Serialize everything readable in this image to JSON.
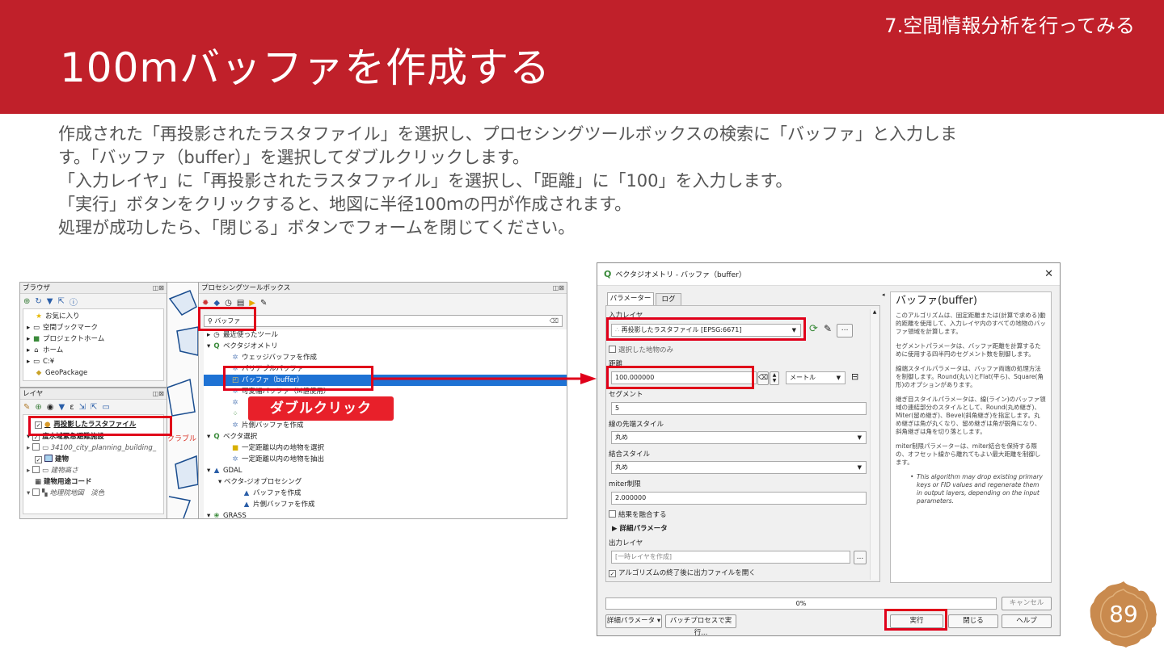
{
  "header": {
    "section": "7.空間情報分析を行ってみる",
    "title": "100mバッファを作成する"
  },
  "instructions": [
    "作成された「再投影されたラスタファイル」を選択し、プロセシングツールボックスの検索に「バッファ」と入力しま",
    "す。「バッファ（buffer）」を選択してダブルクリックします。",
    "「入力レイヤ」に「再投影されたラスタファイル」を選択し、「距離」に「100」を入力します。",
    "「実行」ボタンをクリックすると、地図に半径100ｍの円が作成されます。",
    "処理が成功したら、「閉じる」ボタンでフォームを閉じてください。"
  ],
  "browser_panel": {
    "title": "ブラウザ",
    "items": [
      "お気に入り",
      "空間ブックマーク",
      "プロジェクトホーム",
      "ホーム",
      "C:¥",
      "GeoPackage"
    ]
  },
  "layers_panel": {
    "title": "レイヤ",
    "items": [
      "再投影したラスタファイル",
      "度水域緊急避難施設",
      "34100_city_planning_building_",
      "建物",
      "建物高さ",
      "建物用途コード",
      "地理院地図　淡色"
    ]
  },
  "map_fragment_text": "クラブル",
  "toolbox_panel": {
    "title": "プロセシングツールボックス",
    "search_value": "バッファ",
    "items": [
      "最近使ったツール",
      "ベクタジオメトリ",
      "ウェッジバッファを作成",
      "バリアブルバッファ",
      "バッファ（buffer）",
      "可変幅バッファ（M値使用）",
      "片側バッファを作成",
      "ベクタ選択",
      "一定距離以内の地物を選択",
      "一定距離以内の地物を抽出",
      "GDAL",
      "ベクタ-ジオプロセシング",
      "バッファを作成",
      "片側バッファを作成",
      "GRASS"
    ],
    "callout": "ダブルクリック"
  },
  "dialog": {
    "title": "ベクタジオメトリ - バッファ（buffer）",
    "tabs": [
      "パラメーター",
      "ログ"
    ],
    "input_layer_label": "入力レイヤ",
    "input_layer_value": "再投影したラスタファイル [EPSG:6671]",
    "selected_only_label": "選択した地物のみ",
    "distance_label": "距離",
    "distance_value": "100.000000",
    "distance_unit": "メートル",
    "segments_label": "セグメント",
    "segments_value": "5",
    "end_cap_label": "線の先端スタイル",
    "end_cap_value": "丸め",
    "join_label": "結合スタイル",
    "join_value": "丸め",
    "miter_label": "miter制限",
    "miter_value": "2.000000",
    "dissolve_label": "結果を融合する",
    "advanced_label": "詳細パラメータ",
    "output_label": "出力レイヤ",
    "output_placeholder": "[一時レイヤを作成]",
    "open_output_label": "アルゴリズムの終了後に出力ファイルを開く",
    "progress": "0%",
    "cancel": "キャンセル",
    "advanced_btn": "詳細パラメータ ▾",
    "batch_btn": "バッチプロセスで実行...",
    "run": "実行",
    "close": "閉じる",
    "help": "ヘルプ",
    "help_pane": {
      "title": "バッファ(buffer)",
      "p1": "このアルゴリズムは、固定距離または(計算で求める)動的距離を使用して、入力レイヤ内のすべての地物のバッファ領域を計算します。",
      "p2": "セグメントパラメータは、バッファ距離を計算するために使用する四半円のセグメント数を制御します。",
      "p3": "線端スタイルパラメータは、バッファ両端の処理方法を制御します。Round(丸い)とFlat(平ら)、Square(角形)のオプションがあります。",
      "p4": "継ぎ目スタイルパラメータは、線(ライン)のバッファ領域の連結部分のスタイルとして、Round(丸め継ぎ)、Miter(留め継ぎ)、Bevel(斜角継ぎ)を指定します。丸め継ぎは角が丸くなり、留め継ぎは角が鋭角になり、斜角継ぎは角を切り落とします。",
      "p5": "miter制限パラメーターは、miter結合を保持する際の、オフセット線から離れてもよい最大距離を制御します。",
      "note": "This algorithm may drop existing primary keys or FID values and regenerate them in output layers, depending on the input parameters."
    }
  },
  "page_number": "89",
  "colors": {
    "brand_red": "#c0202a",
    "highlight_red": "#e0001a",
    "selection_blue": "#1e72d4",
    "badge_brown": "#c98a4e"
  }
}
